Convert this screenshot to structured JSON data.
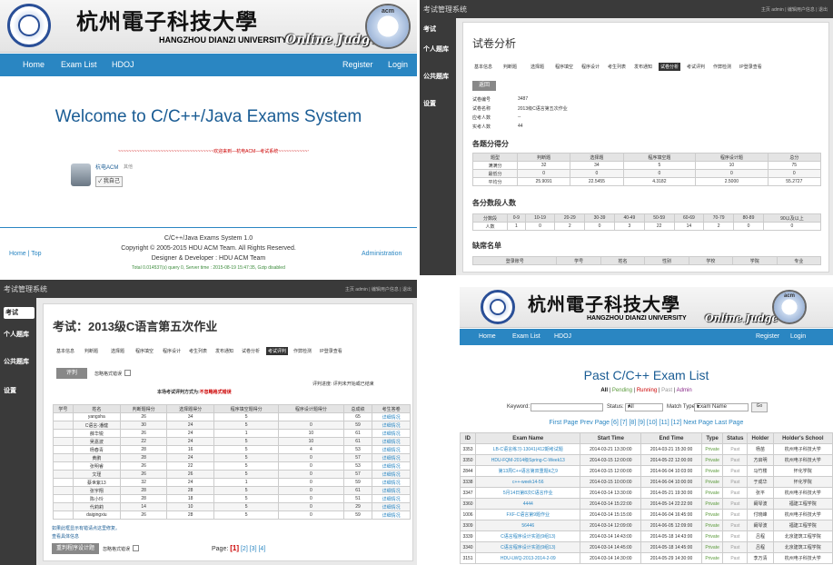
{
  "panelA": {
    "banner": {
      "chinese_title": "杭州電子科技大學",
      "english_title": "HANGZHOU DIANZI UNIVERSITY",
      "online_judge": "Online Judge",
      "acm_badge": "acm"
    },
    "nav": {
      "home": "Home",
      "exam_list": "Exam List",
      "hdoj": "HDOJ",
      "register": "Register",
      "login": "Login"
    },
    "welcome": "Welcome to C/C++/Java Exams System",
    "notice": "~~~~~~~~~~~~~~~~~~~~~~~~~~~~~~~~~~~~欢迎来到—杭电ACM—考试系统~~~~~~~~~~~~~~~~~~~~~~~~~~~~~~~~~~~~",
    "user": {
      "name": "杭电ACM",
      "sub": "其他",
      "button": "我自己"
    },
    "footer": {
      "line1": "C/C++/Java Exams System 1.0",
      "line2": "Copyright © 2005-2015 HDU ACM Team. All Rights Reserved.",
      "line3": "Designer & Developer : HDU ACM Team",
      "line4": "Total 0.014537(s) query 0, Server time : 2015-08-19 15:47:35, Gzip disabled",
      "home_top": "Home | Top",
      "admin": "Administration"
    }
  },
  "panelB": {
    "app_title": "考试管理系统",
    "topright": "主页  admin  |  编辑用户信息  |  退出",
    "side": [
      "考试",
      "个人题库",
      "公共题库",
      "设置"
    ],
    "heading": "试卷分析",
    "tabs": [
      "基本信息",
      "判断题",
      "选择题",
      "程序填空",
      "程序设计",
      "考生列表",
      "发布通知",
      "试卷分析",
      "考试评判",
      "作弊检测",
      "IP登录查看"
    ],
    "active_tab": "试卷分析",
    "back_button": "返回",
    "info": [
      [
        "试卷编号",
        "3487"
      ],
      [
        "试卷名称",
        "2013级C语言第五次作业"
      ],
      [
        "应考人数",
        "--"
      ],
      [
        "实考人数",
        "44"
      ]
    ],
    "score_section": "各题分得分",
    "score_table": {
      "header": [
        "题型",
        "判断题",
        "选择题",
        "程序填空题",
        "程序设计题",
        "总分"
      ],
      "rows": [
        [
          "满满分",
          "32",
          "34",
          "5",
          "10",
          "75"
        ],
        [
          "最低分",
          "0",
          "0",
          "0",
          "0",
          "0"
        ],
        [
          "平均分",
          "25.9091",
          "22.5455",
          "4.3182",
          "2.5000",
          "55.2727"
        ]
      ]
    },
    "dist_section": "各分数段人数",
    "dist_table": {
      "header": [
        "分数段",
        "0-9",
        "10-19",
        "20-29",
        "30-39",
        "40-49",
        "50-59",
        "60-69",
        "70-79",
        "80-89",
        "90以及以上"
      ],
      "rows": [
        [
          "人数",
          "1",
          "0",
          "2",
          "0",
          "3",
          "22",
          "14",
          "2",
          "0",
          "0"
        ]
      ]
    },
    "absent_section": "缺席名单",
    "absent_header": [
      "登录账号",
      "学号",
      "姓名",
      "性别",
      "学校",
      "学院",
      "专业"
    ]
  },
  "panelC": {
    "app_title": "考试管理系统",
    "topright": "主页  admin  |  编辑用户信息  |  退出",
    "side": [
      "考试",
      "个人题库",
      "公共题库",
      "设置"
    ],
    "heading": "考试：2013级C语言第五次作业",
    "tabs": [
      "基本信息",
      "判断题",
      "选择题",
      "程序填空",
      "程序设计",
      "考生列表",
      "发布通知",
      "试卷分析",
      "考试评判",
      "作弊检测",
      "IP登录查看"
    ],
    "active_tab": "考试评判",
    "judge_button": "评判",
    "judge_check": "忽略格式错误",
    "method_prefix": "本场考试评判方式为:",
    "method_value": "不忽略格式错误",
    "progress": "评判进度:  评判未开始或已结束",
    "table": {
      "header": [
        "学号",
        "姓名",
        "判断题得分",
        "选择题得分",
        "程序填空题得分",
        "程序设计题得分",
        "总成绩",
        "考生答卷"
      ],
      "rows": [
        [
          "",
          "yangsha",
          "26",
          "34",
          "5",
          "",
          "65",
          "详细情况"
        ],
        [
          "",
          "C语言-潘健",
          "30",
          "24",
          "5",
          "0",
          "59",
          "详细情况"
        ],
        [
          "",
          "薛华锐",
          "26",
          "24",
          "1",
          "10",
          "61",
          "详细情况"
        ],
        [
          "",
          "吴嘉波",
          "22",
          "24",
          "5",
          "10",
          "61",
          "详细情况"
        ],
        [
          "",
          "杨春青",
          "28",
          "16",
          "5",
          "4",
          "53",
          "详细情况"
        ],
        [
          "",
          "黄鹏",
          "28",
          "24",
          "5",
          "0",
          "57",
          "详细情况"
        ],
        [
          "",
          "张明睿",
          "26",
          "22",
          "5",
          "0",
          "53",
          "详细情况"
        ],
        [
          "",
          "文瑾",
          "26",
          "26",
          "5",
          "0",
          "57",
          "详细情况"
        ],
        [
          "",
          "蔡世紫13",
          "32",
          "24",
          "1",
          "0",
          "59",
          "详细情况"
        ],
        [
          "",
          "张宇翔",
          "28",
          "28",
          "5",
          "0",
          "61",
          "详细情况"
        ],
        [
          "",
          "陈小玲",
          "28",
          "18",
          "5",
          "0",
          "51",
          "详细情况"
        ],
        [
          "",
          "代莉莉",
          "14",
          "10",
          "5",
          "0",
          "29",
          "详细情况"
        ],
        [
          "",
          "daigingxiu",
          "26",
          "28",
          "5",
          "0",
          "59",
          "详细情况"
        ]
      ]
    },
    "page_label": "Page:",
    "pages": [
      "[1]",
      "[2]",
      "[3]",
      "[4]"
    ],
    "note1": "如果此框显示有错请点这里修复。",
    "note2": "查看具体信息",
    "rejudge_button": "重判程序设计题",
    "rejudge_check": "忽略格式错误"
  },
  "panelD": {
    "title": "Past C/C++ Exam List",
    "filters": [
      "All",
      "Pending",
      "Running",
      "Past",
      "Admin"
    ],
    "keyword_label": "Keyword:",
    "status_label": "Status:",
    "status_value": "All",
    "match_label": "Match Type:",
    "match_value": "Exam Name",
    "go": "Go",
    "pagination": "First Page Prev Page [6] [7] [8] [9] [10] [11] [12] Next Page Last Page",
    "table": {
      "header": [
        "ID",
        "Exam Name",
        "Start Time",
        "End Time",
        "Type",
        "Status",
        "Holder",
        "Holder's School"
      ],
      "rows": [
        [
          "3353",
          "LB-C语言练习-13041(412期考试题",
          "2014-03-21 13:30:00",
          "2014-03-21 15:30:00",
          "Private",
          "Past",
          "杨苗",
          "杭州电子科技大学"
        ],
        [
          "3350",
          "HDU-FQM-2014级Spring-C-Week13",
          "2014-03-15 12:00:00",
          "2014-05-22 12:00:00",
          "Private",
          "Past",
          "方启明",
          "杭州电子科技大学"
        ],
        [
          "2844",
          "第13周C++语言第双重题Ⅱ之9",
          "2014-03-15 12:00:00",
          "2014-06-04 10:03:00",
          "Private",
          "Past",
          "马竹楼",
          "怀化学院"
        ],
        [
          "3338",
          "c++-week14-56",
          "2014-03-15 10:00:00",
          "2014-06-04 10:00:00",
          "Private",
          "Past",
          "于成华",
          "怀化学院"
        ],
        [
          "3347",
          "5月14日第8次C语言作业",
          "2014-03-14 13:30:00",
          "2014-05-21 19:30:00",
          "Private",
          "Past",
          "张平",
          "杭州电子科技大学"
        ],
        [
          "3360",
          "4444",
          "2014-03-14 15:22:00",
          "2014-05-14 22:22:00",
          "Private",
          "Past",
          "阚琴波",
          "福建工程学院"
        ],
        [
          "1006",
          "FXF-C语言第9题作业",
          "2014-03-14 15:15:00",
          "2014-06-04 16:45:00",
          "Private",
          "Past",
          "付晓峰",
          "杭州电子科技大学"
        ],
        [
          "3309",
          "56446",
          "2014-03-14 12:09:00",
          "2014-06-05 12:09:00",
          "Private",
          "Past",
          "阚琴波",
          "福建工程学院"
        ],
        [
          "3339",
          "C语言程序设计实验(9组13)",
          "2014-03-14 14:43:00",
          "2014-05-18 14:43:00",
          "Private",
          "Past",
          "吕程",
          "北京建筑工程学院"
        ],
        [
          "3340",
          "C语言程序设计实验(9组13)",
          "2014-03-14 14:45:00",
          "2014-05-18 14:45:00",
          "Private",
          "Past",
          "吕程",
          "北京建筑工程学院"
        ],
        [
          "3151",
          "HDU-LWQ-2013-2014-2-09",
          "2014-03-14 14:30:00",
          "2014-05-29 14:30:00",
          "Private",
          "Past",
          "李万清",
          "杭州电子科技大学"
        ]
      ]
    }
  },
  "colors": {
    "nav_blue": "#2a86c2",
    "dark_bar": "#3a3a3a",
    "title_blue": "#1a5c94",
    "link_green": "#5a9a3a",
    "red": "#cc0000"
  }
}
